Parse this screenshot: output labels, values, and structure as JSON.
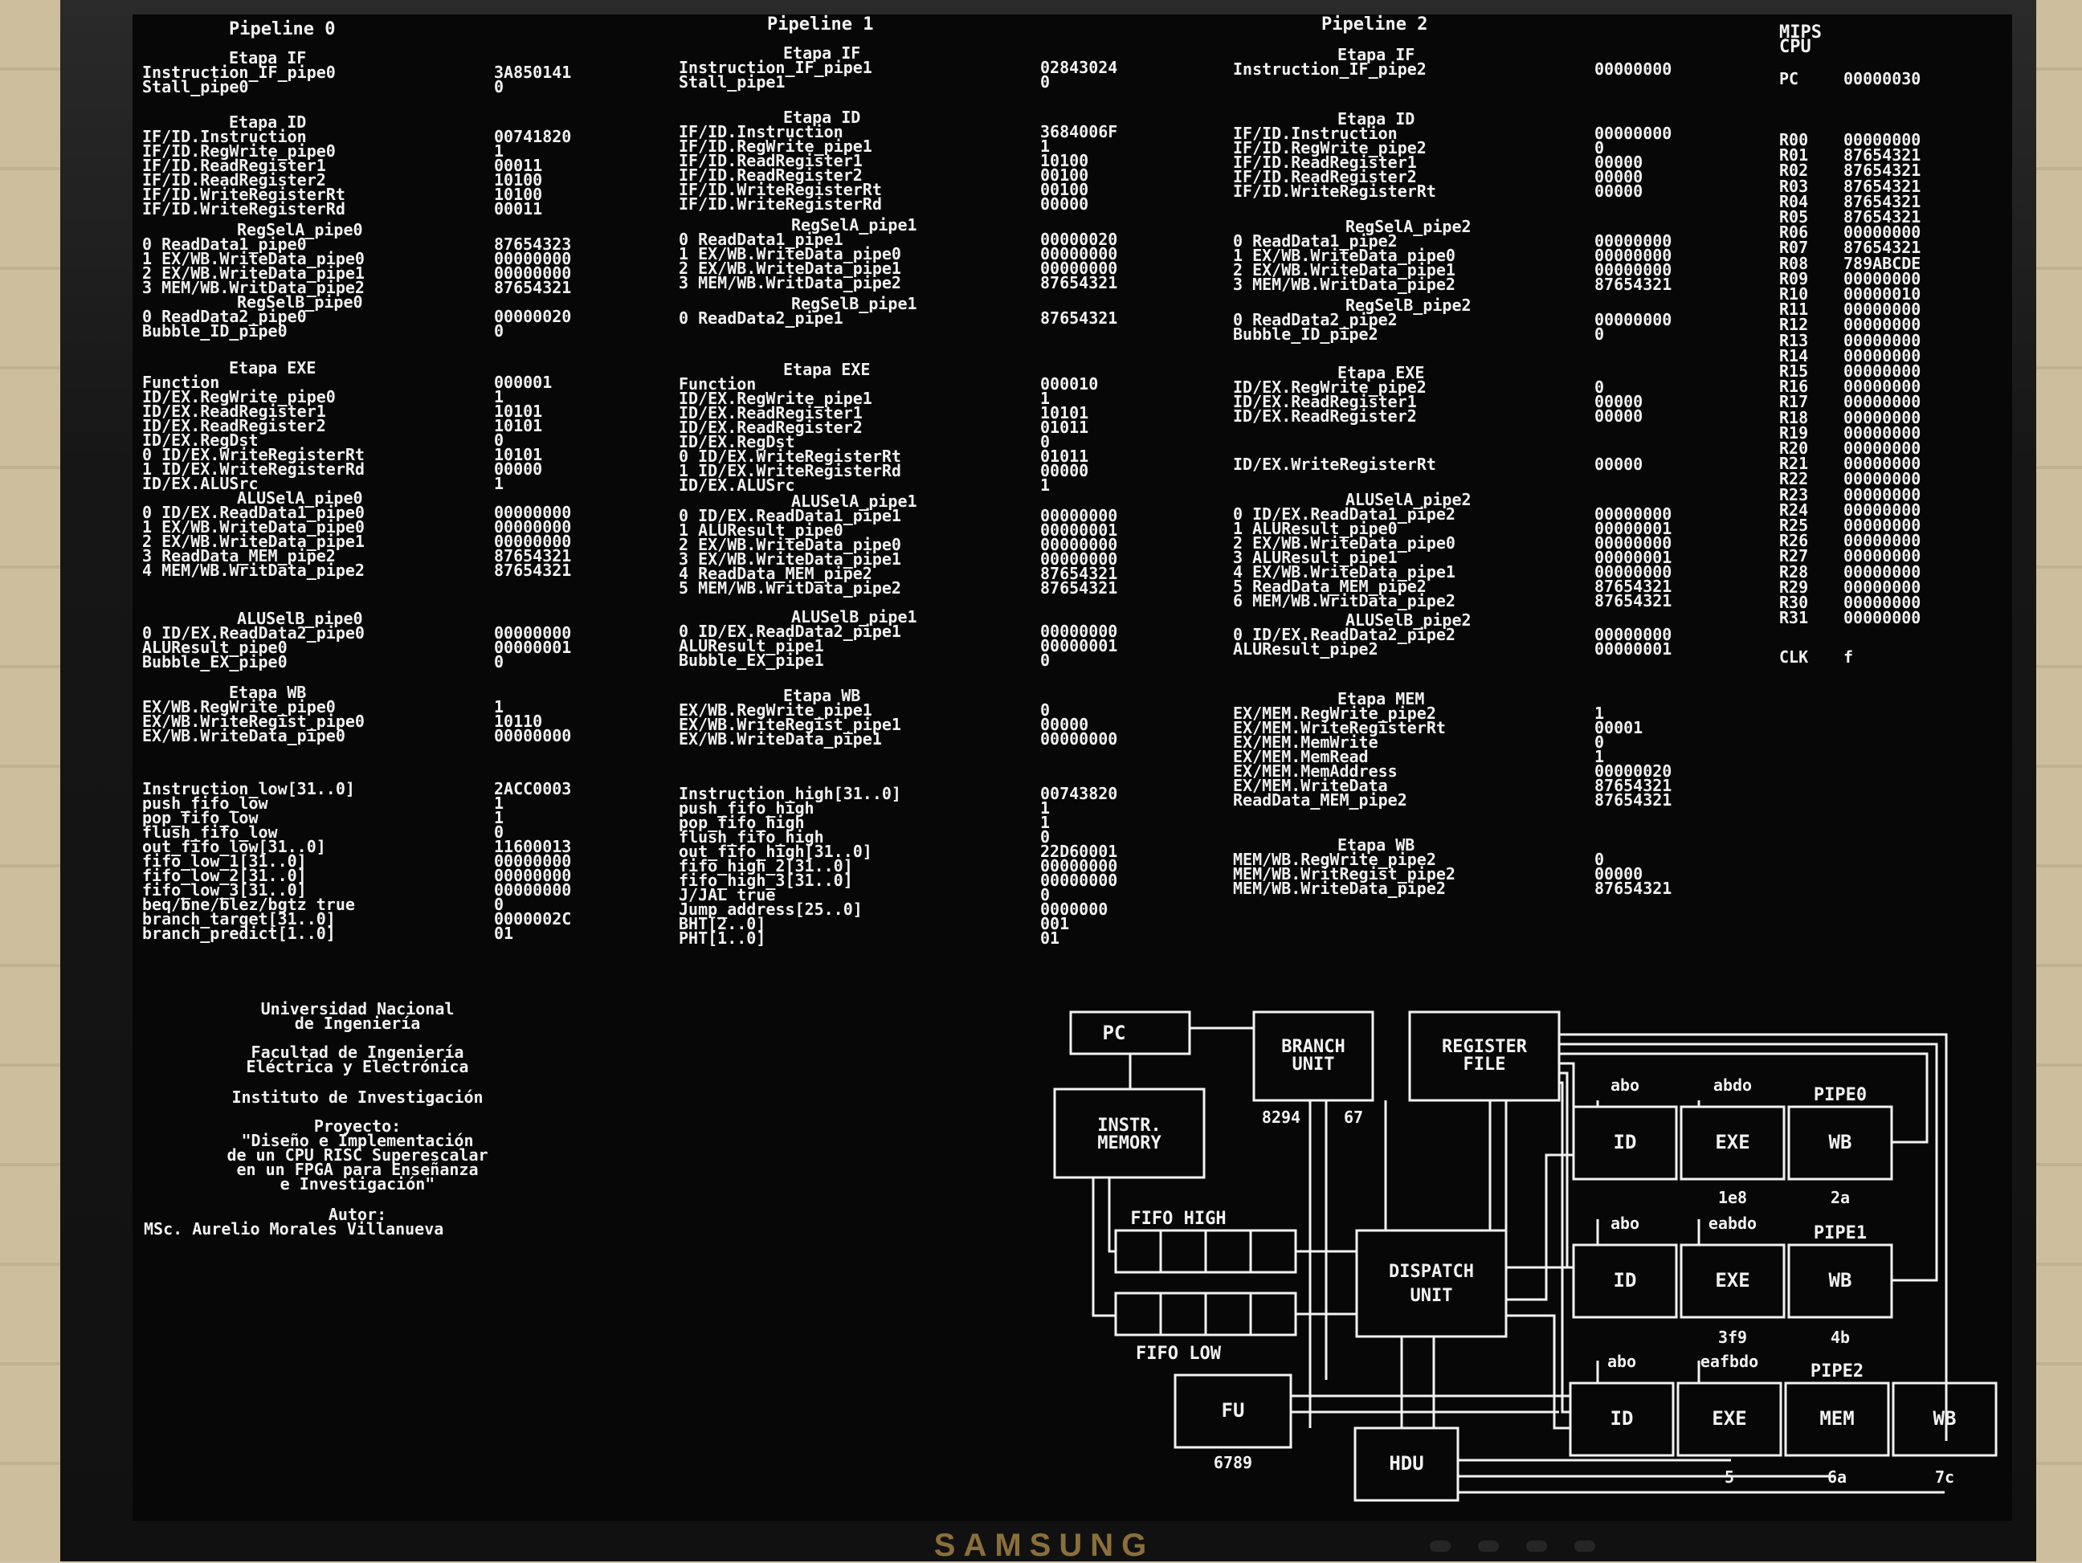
{
  "headers": {
    "p0": "Pipeline 0",
    "p1": "Pipeline 1",
    "p2": "Pipeline 2",
    "mips": "MIPS",
    "cpu": "CPU"
  },
  "p0": {
    "if_title": "Etapa IF",
    "if_rows": [
      [
        "Instruction_IF_pipe0",
        "3A850141"
      ],
      [
        "Stall_pipe0",
        "0"
      ]
    ],
    "id_title": "Etapa ID",
    "id_rows": [
      [
        "IF/ID.Instruction",
        "00741820"
      ],
      [
        "IF/ID.RegWrite_pipe0",
        "1"
      ],
      [
        "IF/ID.ReadRegister1",
        "00011"
      ],
      [
        "IF/ID.ReadRegister2",
        "10100"
      ],
      [
        "IF/ID.WriteRegisterRt",
        "10100"
      ],
      [
        "IF/ID.WriteRegisterRd",
        "00011"
      ]
    ],
    "regsela_title": "RegSelA_pipe0",
    "regsela_rows": [
      [
        "0 ReadData1_pipe0",
        "87654323"
      ],
      [
        "1 EX/WB.WriteData_pipe0",
        "00000000"
      ],
      [
        "2 EX/WB.WriteData_pipe1",
        "00000000"
      ],
      [
        "3 MEM/WB.WritData_pipe2",
        "87654321"
      ]
    ],
    "regselb_title": "RegSelB_pipe0",
    "regselb_rows": [
      [
        "0 ReadData2_pipe0",
        "00000020"
      ],
      [
        "Bubble_ID_pipe0",
        "0"
      ]
    ],
    "exe_title": "Etapa EXE",
    "exe_rows": [
      [
        "Function",
        "000001"
      ],
      [
        "ID/EX.RegWrite_pipe0",
        "1"
      ],
      [
        "ID/EX.ReadRegister1",
        "10101"
      ],
      [
        "ID/EX.ReadRegister2",
        "10101"
      ],
      [
        "ID/EX.RegDst",
        "0"
      ],
      [
        "0 ID/EX.WriteRegisterRt",
        "10101"
      ],
      [
        "1 ID/EX.WriteRegisterRd",
        "00000"
      ],
      [
        "ID/EX.ALUSrc",
        "1"
      ]
    ],
    "alusela_title": "ALUSelA_pipe0",
    "alusela_rows": [
      [
        "0 ID/EX.ReadData1_pipe0",
        "00000000"
      ],
      [
        "1 EX/WB.WriteData_pipe0",
        "00000000"
      ],
      [
        "2 EX/WB.WriteData_pipe1",
        "00000000"
      ],
      [
        "3 ReadData_MEM_pipe2",
        "87654321"
      ],
      [
        "4 MEM/WB.WritData_pipe2",
        "87654321"
      ]
    ],
    "aluselb_title": "ALUSelB_pipe0",
    "aluselb_rows": [
      [
        "0 ID/EX.ReadData2_pipe0",
        "00000000"
      ],
      [
        "ALUResult_pipe0",
        "00000001"
      ],
      [
        "Bubble_EX_pipe0",
        "0"
      ]
    ],
    "wb_title": "Etapa WB",
    "wb_rows": [
      [
        "EX/WB.RegWrite_pipe0",
        "1"
      ],
      [
        "EX/WB.WriteRegist_pipe0",
        "10110"
      ],
      [
        "EX/WB.WriteData_pipe0",
        "00000000"
      ]
    ],
    "fifo_rows": [
      [
        "Instruction_low[31..0]",
        "2ACC0003"
      ],
      [
        "push_fifo_low",
        "1"
      ],
      [
        "pop_fifo_low",
        "1"
      ],
      [
        "flush_fifo_low",
        "0"
      ],
      [
        "out_fifo_low[31..0]",
        "11600013"
      ],
      [
        "fifo_low_1[31..0]",
        "00000000"
      ],
      [
        "fifo_low_2[31..0]",
        "00000000"
      ],
      [
        "fifo_low_3[31..0]",
        "00000000"
      ],
      [
        "beq/bne/blez/bgtz true",
        "0"
      ],
      [
        "branch_target[31..0]",
        "0000002C"
      ],
      [
        "branch_predict[1..0]",
        "01"
      ]
    ]
  },
  "p1": {
    "if_title": "Etapa IF",
    "if_rows": [
      [
        "Instruction_IF_pipe1",
        "02843024"
      ],
      [
        "Stall_pipe1",
        "0"
      ]
    ],
    "id_title": "Etapa ID",
    "id_rows": [
      [
        "IF/ID.Instruction",
        "3684006F"
      ],
      [
        "IF/ID.RegWrite_pipe1",
        "1"
      ],
      [
        "IF/ID.ReadRegister1",
        "10100"
      ],
      [
        "IF/ID.ReadRegister2",
        "00100"
      ],
      [
        "IF/ID.WriteRegisterRt",
        "00100"
      ],
      [
        "IF/ID.WriteRegisterRd",
        "00000"
      ]
    ],
    "regsela_title": "RegSelA_pipe1",
    "regsela_rows": [
      [
        "0 ReadData1_pipe1",
        "00000020"
      ],
      [
        "1 EX/WB.WriteData_pipe0",
        "00000000"
      ],
      [
        "2 EX/WB.WriteData_pipe1",
        "00000000"
      ],
      [
        "3 MEM/WB.WritData_pipe2",
        "87654321"
      ]
    ],
    "regselb_title": "RegSelB_pipe1",
    "regselb_rows": [
      [
        "0 ReadData2_pipe1",
        "87654321"
      ]
    ],
    "exe_title": "Etapa EXE",
    "exe_rows": [
      [
        "Function",
        "000010"
      ],
      [
        "ID/EX.RegWrite_pipe1",
        "1"
      ],
      [
        "ID/EX.ReadRegister1",
        "10101"
      ],
      [
        "ID/EX.ReadRegister2",
        "01011"
      ],
      [
        "ID/EX.RegDst",
        "0"
      ],
      [
        "0 ID/EX.WriteRegisterRt",
        "01011"
      ],
      [
        "1 ID/EX.WriteRegisterRd",
        "00000"
      ],
      [
        "ID/EX.ALUSrc",
        "1"
      ]
    ],
    "alusela_title": "ALUSelA_pipe1",
    "alusela_rows": [
      [
        "0 ID/EX.ReadData1_pipe1",
        "00000000"
      ],
      [
        "1 ALUResult_pipe0",
        "00000001"
      ],
      [
        "2 EX/WB.WriteData_pipe0",
        "00000000"
      ],
      [
        "3 EX/WB.WriteData_pipe1",
        "00000000"
      ],
      [
        "4 ReadData_MEM_pipe2",
        "87654321"
      ],
      [
        "5 MEM/WB.WritData_pipe2",
        "87654321"
      ]
    ],
    "aluselb_title": "ALUSelB_pipe1",
    "aluselb_rows": [
      [
        "0 ID/EX.ReadData2_pipe1",
        "00000000"
      ],
      [
        "ALUResult_pipe1",
        "00000001"
      ],
      [
        "Bubble_EX_pipe1",
        "0"
      ]
    ],
    "wb_title": "Etapa WB",
    "wb_rows": [
      [
        "EX/WB.RegWrite_pipe1",
        "0"
      ],
      [
        "EX/WB.WriteRegist_pipe1",
        "00000"
      ],
      [
        "EX/WB.WriteData_pipe1",
        "00000000"
      ]
    ],
    "fifo_rows": [
      [
        "Instruction_high[31..0]",
        "00743820"
      ],
      [
        "push_fifo_high",
        "1"
      ],
      [
        "pop_fifo_high",
        "1"
      ],
      [
        "flush_fifo_high",
        "0"
      ],
      [
        "out_fifo_high[31..0]",
        "22D60001"
      ],
      [
        "fifo_high_2[31..0]",
        "00000000"
      ],
      [
        "fifo_high_3[31..0]",
        "00000000"
      ],
      [
        "J/JAL true",
        "0"
      ],
      [
        "Jump_address[25..0]",
        "0000000"
      ],
      [
        "BHT[2..0]",
        "001"
      ],
      [
        "PHT[1..0]",
        "01"
      ]
    ]
  },
  "p2": {
    "if_title": "Etapa IF",
    "if_rows": [
      [
        "Instruction_IF_pipe2",
        "00000000"
      ]
    ],
    "id_title": "Etapa ID",
    "id_rows": [
      [
        "IF/ID.Instruction",
        "00000000"
      ],
      [
        "IF/ID.RegWrite_pipe2",
        "0"
      ],
      [
        "IF/ID.ReadRegister1",
        "00000"
      ],
      [
        "IF/ID.ReadRegister2",
        "00000"
      ],
      [
        "IF/ID.WriteRegisterRt",
        "00000"
      ]
    ],
    "regsela_title": "RegSelA_pipe2",
    "regsela_rows": [
      [
        "0 ReadData1_pipe2",
        "00000000"
      ],
      [
        "1 EX/WB.WriteData_pipe0",
        "00000000"
      ],
      [
        "2 EX/WB.WriteData_pipe1",
        "00000000"
      ],
      [
        "3 MEM/WB.WritData_pipe2",
        "87654321"
      ]
    ],
    "regselb_title": "RegSelB_pipe2",
    "regselb_rows": [
      [
        "0 ReadData2_pipe2",
        "00000000"
      ],
      [
        "Bubble_ID_pipe2",
        "0"
      ]
    ],
    "exe_title": "Etapa EXE",
    "exe_rows": [
      [
        "ID/EX.RegWrite_pipe2",
        "0"
      ],
      [
        "ID/EX.ReadRegister1",
        "00000"
      ],
      [
        "ID/EX.ReadRegister2",
        "00000"
      ]
    ],
    "exe_rows_b": [
      [
        "ID/EX.WriteRegisterRt",
        "00000"
      ]
    ],
    "alusela_title": "ALUSelA_pipe2",
    "alusela_rows": [
      [
        "0 ID/EX.ReadData1_pipe2",
        "00000000"
      ],
      [
        "1 ALUResult_pipe0",
        "00000001"
      ],
      [
        "2 EX/WB.WriteData_pipe0",
        "00000000"
      ],
      [
        "3 ALUResult_pipe1",
        "00000001"
      ],
      [
        "4 EX/WB.WriteData_pipe1",
        "00000000"
      ],
      [
        "5 ReadData_MEM_pipe2",
        "87654321"
      ],
      [
        "6 MEM/WB.WritData_pipe2",
        "87654321"
      ]
    ],
    "aluselb_title": "ALUSelB_pipe2",
    "aluselb_rows": [
      [
        "0 ID/EX.ReadData2_pipe2",
        "00000000"
      ],
      [
        "ALUResult_pipe2",
        "00000001"
      ]
    ],
    "mem_title": "Etapa MEM",
    "mem_rows": [
      [
        "EX/MEM.RegWrite_pipe2",
        "1"
      ],
      [
        "EX/MEM.WriteRegisterRt",
        "00001"
      ],
      [
        "EX/MEM.MemWrite",
        "0"
      ],
      [
        "EX/MEM.MemRead",
        "1"
      ],
      [
        "EX/MEM.MemAddress",
        "00000020"
      ],
      [
        "EX/MEM.WriteData",
        "87654321"
      ],
      [
        "ReadData_MEM_pipe2",
        "87654321"
      ]
    ],
    "wb_title": "Etapa WB",
    "wb_rows": [
      [
        "MEM/WB.RegWrite_pipe2",
        "0"
      ],
      [
        "MEM/WB.WritRegist_pipe2",
        "00000"
      ],
      [
        "MEM/WB.WriteData_pipe2",
        "87654321"
      ]
    ]
  },
  "cpu": {
    "pc_label": "PC",
    "pc_value": "00000030",
    "registers": [
      [
        "R00",
        "00000000"
      ],
      [
        "R01",
        "87654321"
      ],
      [
        "R02",
        "87654321"
      ],
      [
        "R03",
        "87654321"
      ],
      [
        "R04",
        "87654321"
      ],
      [
        "R05",
        "87654321"
      ],
      [
        "R06",
        "00000000"
      ],
      [
        "R07",
        "87654321"
      ],
      [
        "R08",
        "789ABCDE"
      ],
      [
        "R09",
        "00000000"
      ],
      [
        "R10",
        "00000010"
      ],
      [
        "R11",
        "00000000"
      ],
      [
        "R12",
        "00000000"
      ],
      [
        "R13",
        "00000000"
      ],
      [
        "R14",
        "00000000"
      ],
      [
        "R15",
        "00000000"
      ],
      [
        "R16",
        "00000000"
      ],
      [
        "R17",
        "00000000"
      ],
      [
        "R18",
        "00000000"
      ],
      [
        "R19",
        "00000000"
      ],
      [
        "R20",
        "00000000"
      ],
      [
        "R21",
        "00000000"
      ],
      [
        "R22",
        "00000000"
      ],
      [
        "R23",
        "00000000"
      ],
      [
        "R24",
        "00000000"
      ],
      [
        "R25",
        "00000000"
      ],
      [
        "R26",
        "00000000"
      ],
      [
        "R27",
        "00000000"
      ],
      [
        "R28",
        "00000000"
      ],
      [
        "R29",
        "00000000"
      ],
      [
        "R30",
        "00000000"
      ],
      [
        "R31",
        "00000000"
      ]
    ],
    "clk_label": "CLK",
    "clk_value": "f"
  },
  "credits": {
    "uni1": "Universidad Nacional",
    "uni2": "de Ingeniería",
    "fac1": "Facultad de Ingeniería",
    "fac2": "Eléctrica y Electrónica",
    "inst": "Instituto de Investigación",
    "proj_label": "Proyecto:",
    "proj1": "\"Diseño e Implementación",
    "proj2": "de un CPU RISC Superescalar",
    "proj3": "en un FPGA para Enseñanza",
    "proj4": "e Investigación\"",
    "autor_label": "Autor:",
    "autor": "MSc. Aurelio Morales Villanueva"
  },
  "diagram": {
    "pc": "PC",
    "branch1": "BRANCH",
    "branch2": "UNIT",
    "regfile1": "REGISTER",
    "regfile2": "FILE",
    "imem1": "INSTR.",
    "imem2": "MEMORY",
    "fifo_high": "FIFO HIGH",
    "fifo_low": "FIFO LOW",
    "disp1": "DISPATCH",
    "disp2": "UNIT",
    "fu": "FU",
    "hdu": "HDU",
    "id": "ID",
    "exe": "EXE",
    "wb": "WB",
    "mem": "MEM",
    "pipe0": "PIPE0",
    "pipe1": "PIPE1",
    "pipe2": "PIPE2",
    "bu_in": "8294",
    "bu_in2": "67",
    "fu_in": "6789",
    "abo": "abo",
    "abdo": "abdo",
    "eabdo": "eabdo",
    "eafbdo": "eafbdo",
    "p0_out1": "1e8",
    "p0_out2": "2a",
    "p1_out1": "3f9",
    "p1_out2": "4b",
    "p2_o1": "5",
    "p2_o2": "6a",
    "p2_o3": "7c"
  },
  "monitor": {
    "brand": "SAMSUNG"
  }
}
